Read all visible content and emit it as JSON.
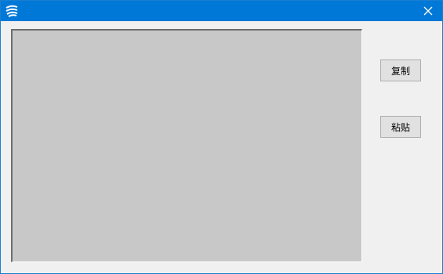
{
  "window": {
    "title": "",
    "close_icon": "close-icon",
    "app_icon": "app-logo-icon"
  },
  "buttons": {
    "copy_label": "复制",
    "paste_label": "粘贴"
  },
  "colors": {
    "titlebar": "#0078d7",
    "client_bg": "#f0f0f0",
    "display_bg": "#c8c8c8"
  }
}
